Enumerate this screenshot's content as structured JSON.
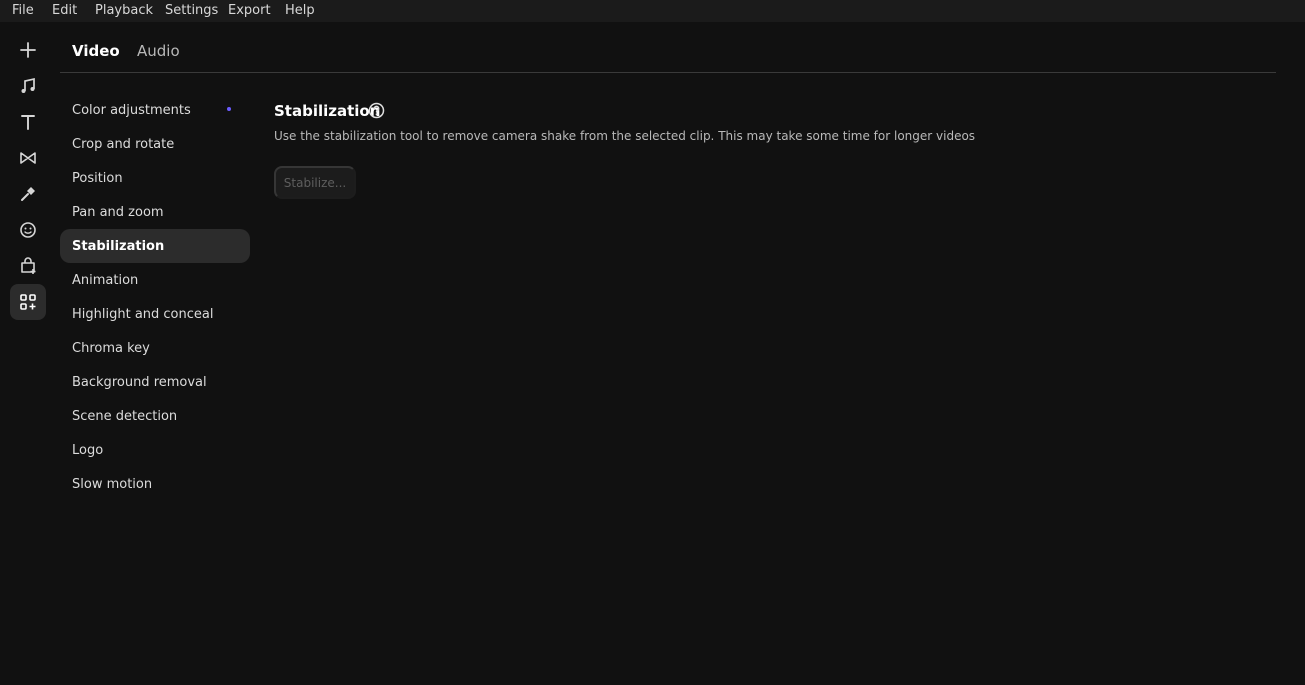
{
  "menu": {
    "items": [
      "File",
      "Edit",
      "Playback",
      "Settings",
      "Export",
      "Help"
    ]
  },
  "rail": {
    "icons": [
      "plus-icon",
      "music-note-icon",
      "text-icon",
      "transition-icon",
      "magic-wand-icon",
      "emoji-icon",
      "bag-plus-icon",
      "apps-plus-icon"
    ],
    "active": "apps-plus-icon"
  },
  "tabs": [
    {
      "label": "Video",
      "active": true
    },
    {
      "label": "Audio",
      "active": false
    }
  ],
  "subnav": {
    "items": [
      "Color adjustments",
      "Crop and rotate",
      "Position",
      "Pan and zoom",
      "Stabilization",
      "Animation",
      "Highlight and conceal",
      "Chroma key",
      "Background removal",
      "Scene detection",
      "Logo",
      "Slow motion"
    ],
    "active": "Stabilization",
    "indicator_color": "#6b5cff"
  },
  "panel": {
    "title": "Stabilization",
    "description": "Use the stabilization tool to remove camera shake from the selected clip. This may take some time for longer videos",
    "button_label": "Stabilize..."
  }
}
